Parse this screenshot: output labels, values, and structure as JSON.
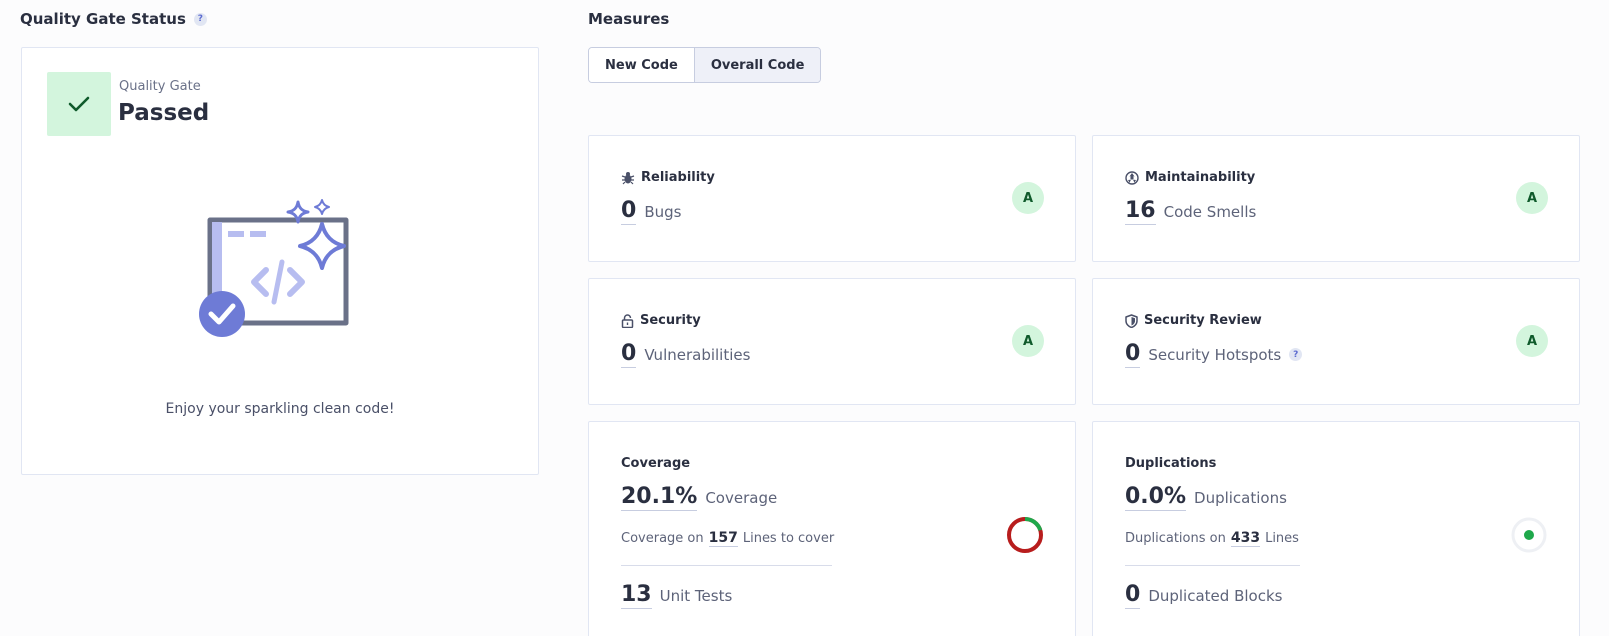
{
  "quality_gate": {
    "title": "Quality Gate Status",
    "help": "?",
    "caption": "Quality Gate",
    "status": "Passed",
    "message": "Enjoy your sparkling clean code!"
  },
  "measures": {
    "title": "Measures",
    "tabs": [
      {
        "label": "New Code",
        "active": false
      },
      {
        "label": "Overall Code",
        "active": true
      }
    ],
    "reliability": {
      "title": "Reliability",
      "value": "0",
      "label": "Bugs",
      "rating": "A"
    },
    "maintainability": {
      "title": "Maintainability",
      "value": "16",
      "label": "Code Smells",
      "rating": "A"
    },
    "security": {
      "title": "Security",
      "value": "0",
      "label": "Vulnerabilities",
      "rating": "A"
    },
    "security_review": {
      "title": "Security Review",
      "value": "0",
      "label": "Security Hotspots",
      "rating": "A",
      "help": "?"
    },
    "coverage": {
      "title": "Coverage",
      "value": "20.1%",
      "label": "Coverage",
      "sub_prefix": "Coverage on",
      "sub_value": "157",
      "sub_suffix": "Lines to cover",
      "tests_value": "13",
      "tests_label": "Unit Tests",
      "fraction": 0.201
    },
    "duplications": {
      "title": "Duplications",
      "value": "0.0%",
      "label": "Duplications",
      "sub_prefix": "Duplications on",
      "sub_value": "433",
      "sub_suffix": "Lines",
      "blocks_value": "0",
      "blocks_label": "Duplicated Blocks"
    }
  },
  "colors": {
    "pass_bg": "#d3f5dd",
    "pass_fg": "#0f5a2b",
    "accent": "#5d6cd0",
    "coverage_covered": "#1fa84b",
    "coverage_uncovered": "#b81d1d",
    "duplication_dot": "#1fa84b"
  }
}
